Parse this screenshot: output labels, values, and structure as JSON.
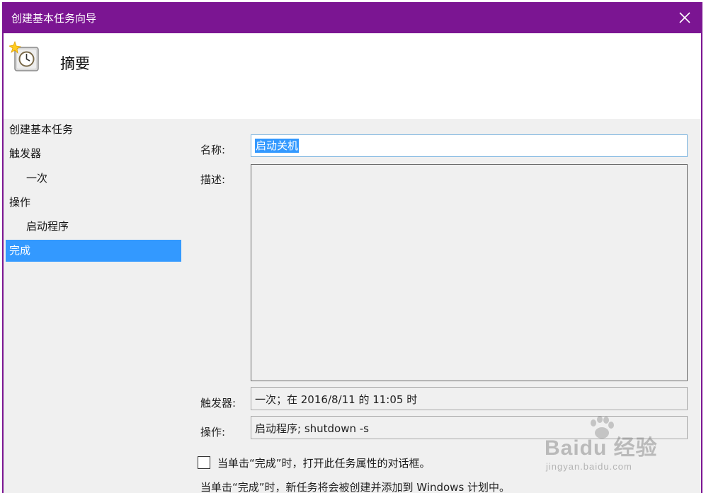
{
  "window": {
    "title": "创建基本任务向导"
  },
  "header": {
    "title": "摘要",
    "icon": "clock-icon"
  },
  "nav": {
    "items": [
      {
        "label": "创建基本任务",
        "level": 0,
        "active": false
      },
      {
        "label": "触发器",
        "level": 0,
        "active": false
      },
      {
        "label": "一次",
        "level": 1,
        "active": false
      },
      {
        "label": "操作",
        "level": 0,
        "active": false
      },
      {
        "label": "启动程序",
        "level": 1,
        "active": false
      },
      {
        "label": "完成",
        "level": 0,
        "active": true
      }
    ]
  },
  "form": {
    "name_label": "名称:",
    "name_value": "启动关机",
    "desc_label": "描述:",
    "desc_value": "",
    "trigger_label": "触发器:",
    "trigger_value": "一次；在 2016/8/11 的 11:05 时",
    "action_label": "操作:",
    "action_value": "启动程序; shutdown -s"
  },
  "options": {
    "open_props_label": "当单击“完成”时，打开此任务属性的对话框。",
    "open_props_checked": false
  },
  "info": "当单击“完成”时，新任务将会被创建并添加到 Windows 计划中。",
  "watermark": {
    "logo": "Baidu 经验",
    "url": "jingyan.baidu.com"
  },
  "colors": {
    "titlebar": "#7b1592",
    "selection": "#3399ff",
    "background": "#f0f0f0"
  }
}
